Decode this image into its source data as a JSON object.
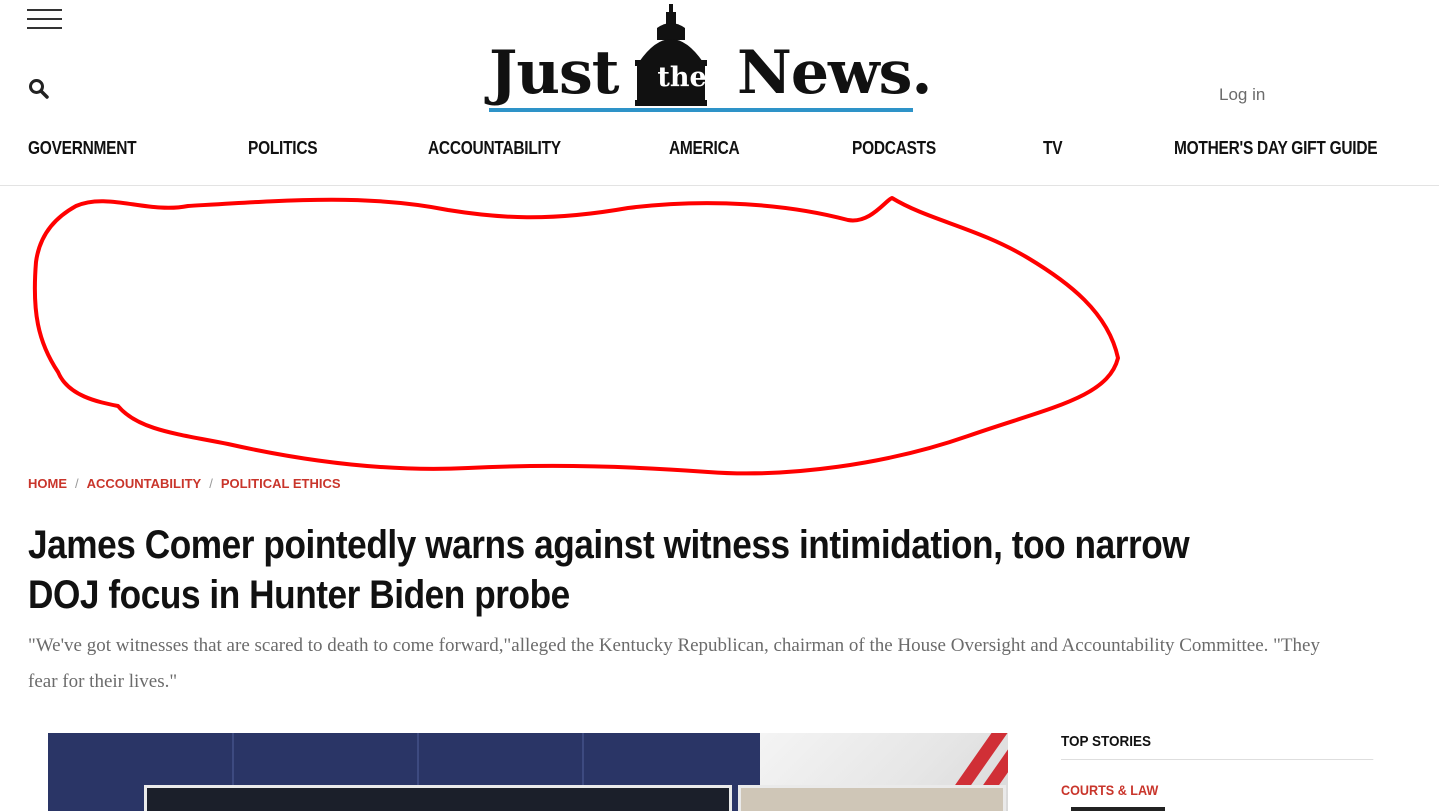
{
  "header": {
    "logo": {
      "left": "Just",
      "middle": "the",
      "right": "News."
    },
    "login_label": "Log in"
  },
  "nav": {
    "items": [
      {
        "label": "GOVERNMENT"
      },
      {
        "label": "POLITICS"
      },
      {
        "label": "ACCOUNTABILITY"
      },
      {
        "label": "AMERICA"
      },
      {
        "label": "PODCASTS"
      },
      {
        "label": "TV"
      },
      {
        "label": "MOTHER'S DAY GIFT GUIDE"
      }
    ]
  },
  "breadcrumb": {
    "items": [
      {
        "label": "HOME"
      },
      {
        "label": "ACCOUNTABILITY"
      },
      {
        "label": "POLITICAL ETHICS"
      }
    ],
    "separator": "/"
  },
  "article": {
    "headline": "James Comer pointedly warns against witness intimidation, too narrow DOJ focus in Hunter Biden probe",
    "subhead": "\"We've got witnesses that are scared to death to come forward,\"alleged the Kentucky Republican, chairman of the House Oversight and Accountability Committee. \"They fear for their lives.\""
  },
  "sidebar": {
    "title": "TOP STORIES",
    "category": "COURTS & LAW"
  },
  "colors": {
    "accent_red": "#c9352b",
    "logo_blue": "#2e93c8",
    "annotation_red": "#ff0000"
  }
}
